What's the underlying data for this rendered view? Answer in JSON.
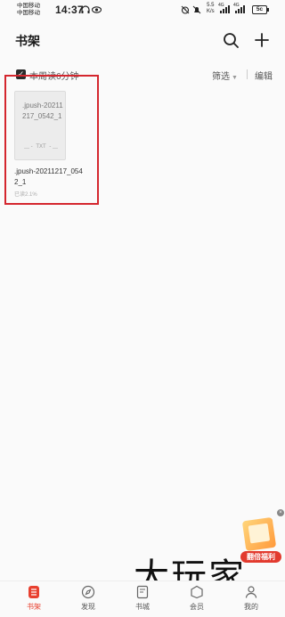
{
  "status_bar": {
    "carrier_1": "中国移动",
    "carrier_2": "中国移动",
    "time": "14:37",
    "net_speed_value": "5.5",
    "net_speed_unit": "K/s",
    "net_type_1": "4G",
    "net_type_2": "4G",
    "battery": "5c"
  },
  "header": {
    "title": "书架",
    "search_icon": "search-icon",
    "add_icon": "plus-icon"
  },
  "toolbar": {
    "reading_time": "本周读6分钟",
    "filter_label": "筛选",
    "edit_label": "编辑"
  },
  "books": [
    {
      "cover_title": ".jpush-20211217_0542_1",
      "cover_type": "TXT",
      "name": ".jpush-20211217_0542_1",
      "progress": "已读2.1%"
    }
  ],
  "promo": {
    "label": "翻倍福利"
  },
  "watermark": "大玩家",
  "bottom_nav": {
    "items": [
      {
        "label": "书架",
        "icon": "bookshelf-icon",
        "active": true
      },
      {
        "label": "发现",
        "icon": "compass-icon",
        "active": false
      },
      {
        "label": "书城",
        "icon": "book-store-icon",
        "active": false
      },
      {
        "label": "会员",
        "icon": "vip-icon",
        "active": false
      },
      {
        "label": "我的",
        "icon": "profile-icon",
        "active": false
      }
    ]
  },
  "colors": {
    "accent": "#e8402f",
    "highlight_border": "#d4262e"
  }
}
